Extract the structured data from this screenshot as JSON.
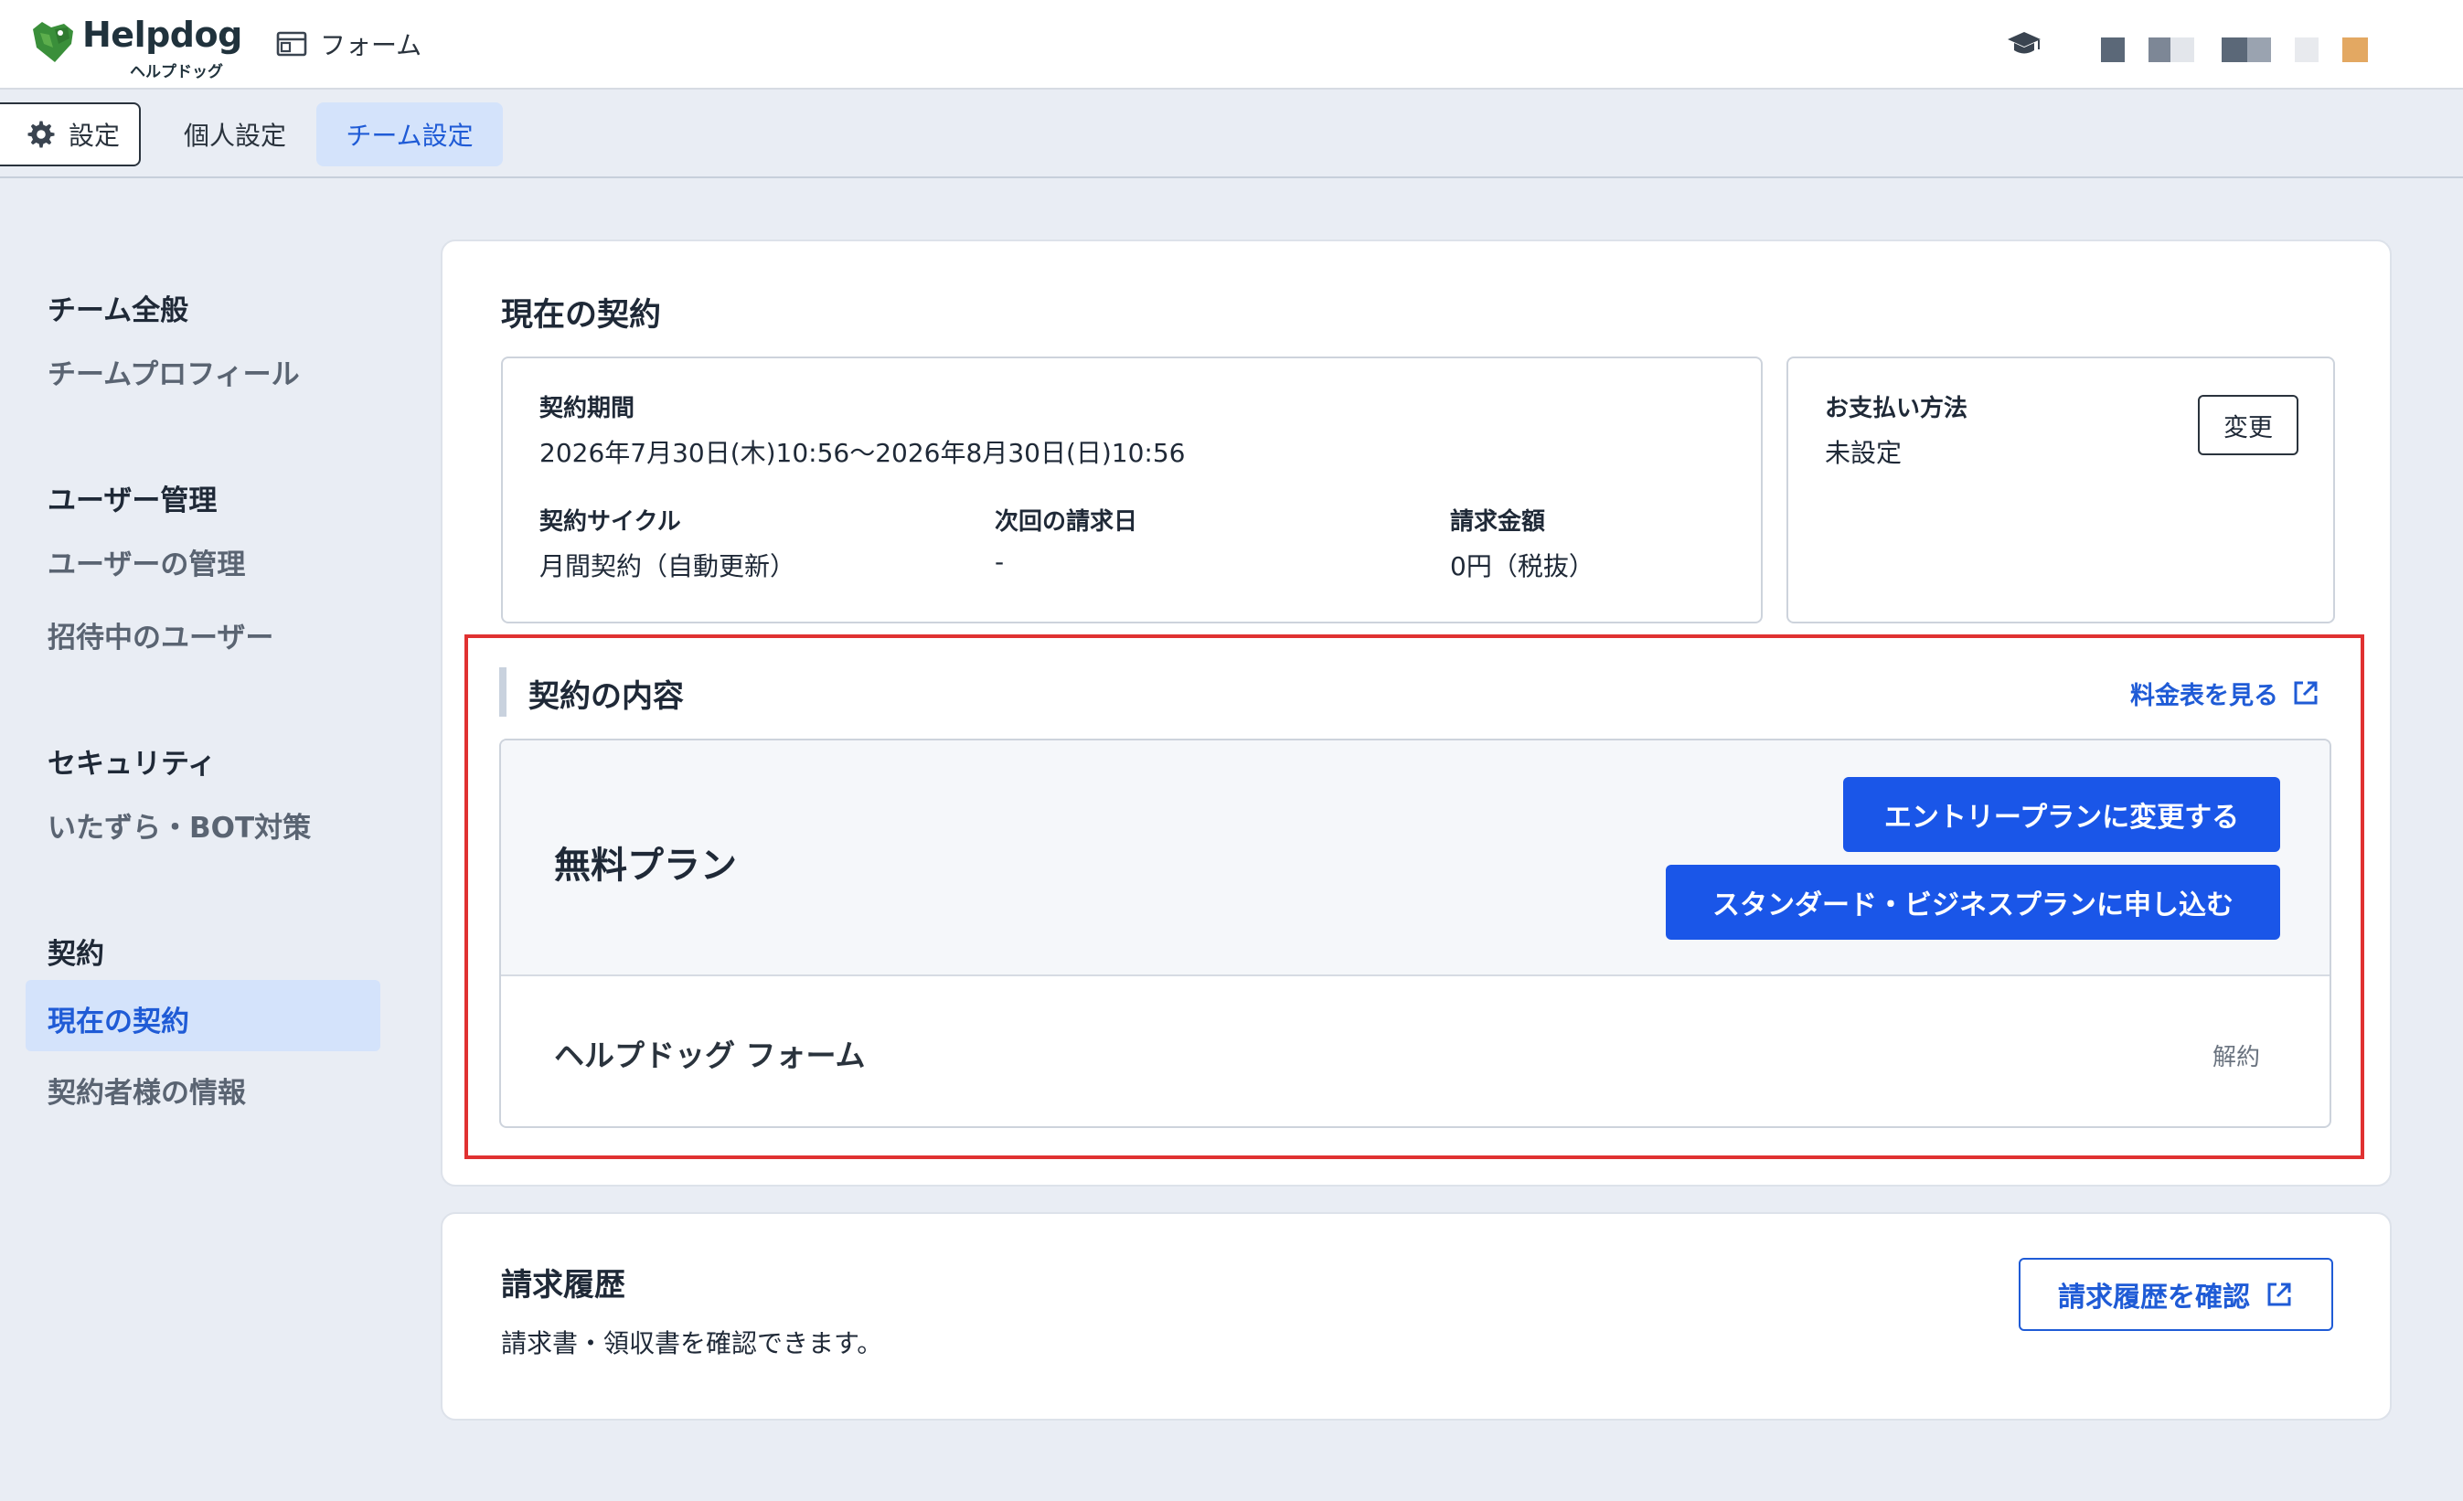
{
  "header": {
    "brand_name": "Helpdog",
    "brand_sub": "ヘルプドッグ",
    "product_label": "フォーム",
    "help_icon": "graduation-cap-icon",
    "swatch_colors": [
      "#5b6878",
      "#7d8796",
      "#c7ccd4",
      "#5b6878",
      "#9aa3b0",
      "#e8eaee",
      "#e3a862"
    ]
  },
  "tabs": {
    "settings": "設定",
    "personal": "個人設定",
    "team": "チーム設定"
  },
  "sidebar": {
    "groups": [
      {
        "heading": "チーム全般",
        "items": [
          "チームプロフィール"
        ]
      },
      {
        "heading": "ユーザー管理",
        "items": [
          "ユーザーの管理",
          "招待中のユーザー"
        ]
      },
      {
        "heading": "セキュリティ",
        "items": [
          "いたずら・BOT対策"
        ]
      },
      {
        "heading": "契約",
        "items": [
          "現在の契約",
          "契約者様の情報"
        ]
      }
    ],
    "active_item": "現在の契約"
  },
  "contract": {
    "title": "現在の契約",
    "period_label": "契約期間",
    "period_value": "2026年7月30日(木)10:56〜2026年8月30日(日)10:56",
    "cycle_label": "契約サイクル",
    "cycle_value": "月間契約（自動更新）",
    "next_billing_label": "次回の請求日",
    "next_billing_value": "-",
    "amount_label": "請求金額",
    "amount_value": "0円（税抜）",
    "payment_label": "お支払い方法",
    "payment_value": "未設定",
    "change_button": "変更"
  },
  "plan": {
    "section_title": "契約の内容",
    "price_link": "料金表を見る",
    "plan_name": "無料プラン",
    "entry_button": "エントリープランに変更する",
    "standard_button": "スタンダード・ビジネスプランに申し込む",
    "product_name": "ヘルプドッグ フォーム",
    "cancel_link": "解約"
  },
  "billing": {
    "title": "請求履歴",
    "description": "請求書・領収書を確認できます。",
    "button": "請求履歴を確認"
  }
}
